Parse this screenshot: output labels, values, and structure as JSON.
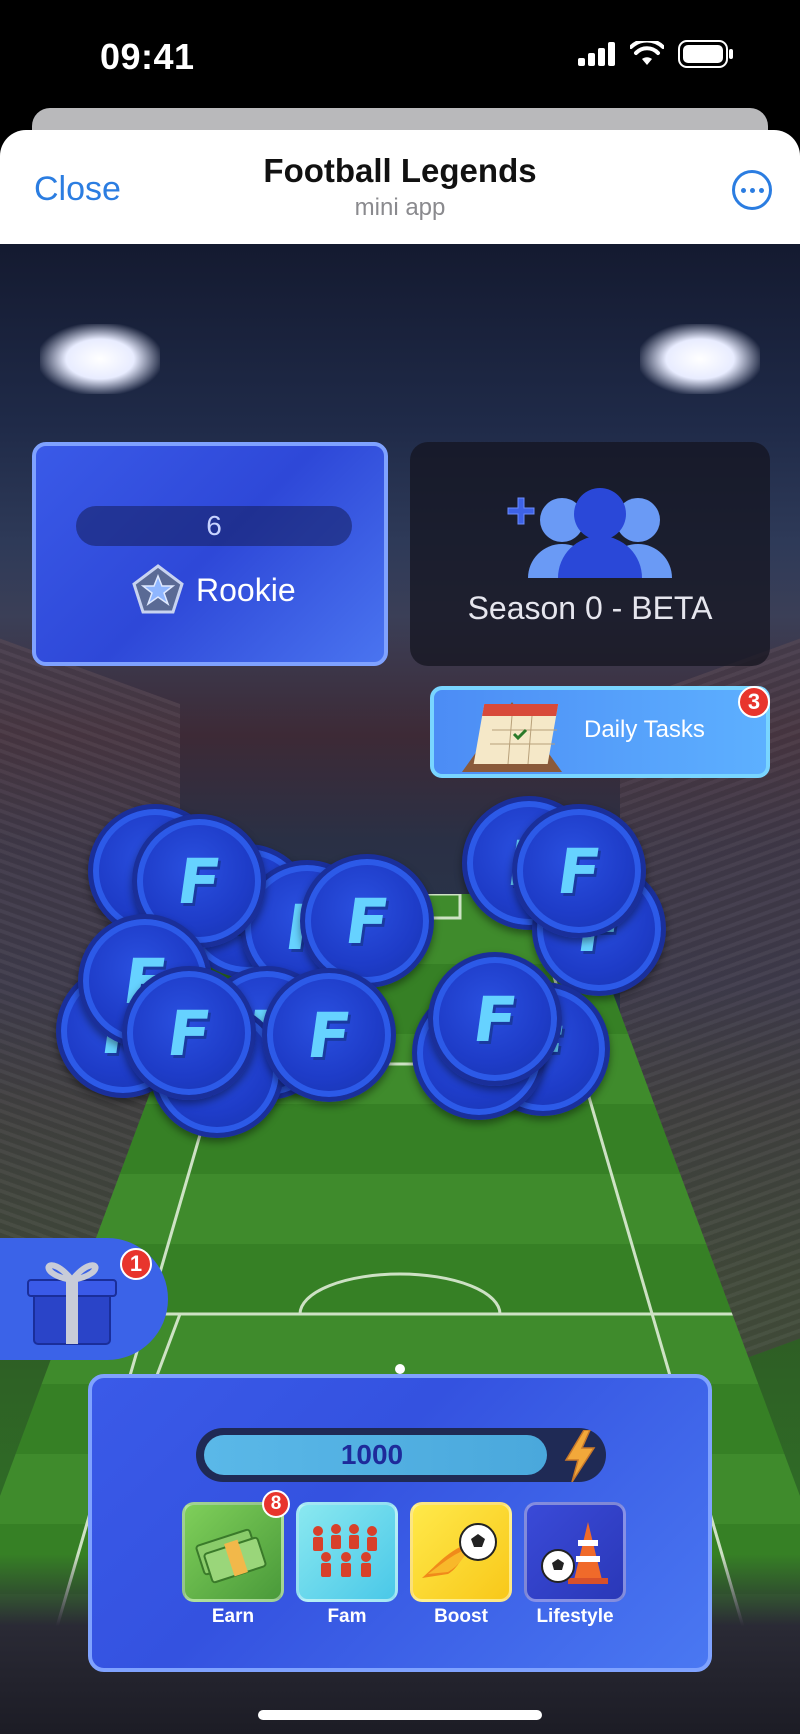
{
  "status_bar": {
    "time": "09:41"
  },
  "header": {
    "close_label": "Close",
    "title": "Football Legends",
    "subtitle": "mini app"
  },
  "rank_card": {
    "level": "6",
    "rank": "Rookie"
  },
  "season_card": {
    "label": "Season 0 - BETA"
  },
  "daily_tasks": {
    "label": "Daily Tasks",
    "badge": "3"
  },
  "coins": {
    "letter": "F"
  },
  "gift": {
    "badge": "1"
  },
  "energy": {
    "value": "1000",
    "level": 0.87
  },
  "nav": [
    {
      "label": "Earn",
      "badge": "8",
      "icon": "money-icon"
    },
    {
      "label": "Fam",
      "icon": "team-icon"
    },
    {
      "label": "Boost",
      "icon": "fireball-icon"
    },
    {
      "label": "Lifestyle",
      "icon": "ball-cone-icon"
    }
  ],
  "colors": {
    "accent": "#2b7de1",
    "panel": "#3a5ae8",
    "badge": "#e8352d"
  }
}
